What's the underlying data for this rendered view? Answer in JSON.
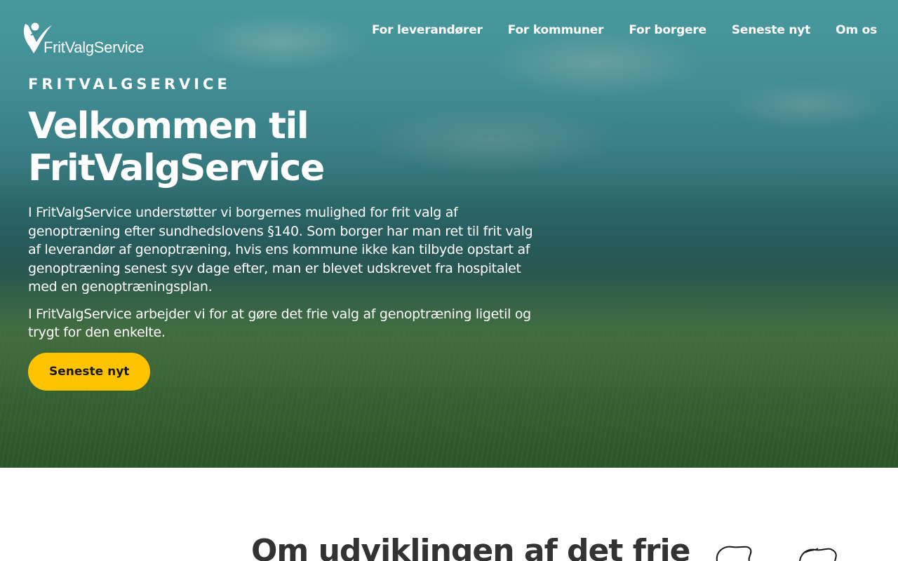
{
  "logo": {
    "text": "FritValgService",
    "icon": "checkmark-person-icon"
  },
  "nav": {
    "items": [
      {
        "label": "For leverandører"
      },
      {
        "label": "For kommuner"
      },
      {
        "label": "For borgere"
      },
      {
        "label": "Seneste nyt"
      },
      {
        "label": "Om os"
      }
    ]
  },
  "hero": {
    "eyebrow": "FRITVALGSERVICE",
    "title": "Velkommen til FritValgService",
    "paragraphs": [
      "I FritValgService understøtter vi borgernes mulighed for frit valg af genoptræning efter sundhedslovens §140. Som borger har man ret til frit valg af leverandør af genoptræning, hvis ens kommune ikke kan tilbyde opstart af genoptræning senest syv dage efter, man er blevet udskrevet fra hospitalet med en genoptræningsplan.",
      "I FritValgService arbejder vi for at gøre det frie valg af genoptræning ligetil og trygt for den enkelte."
    ],
    "cta_label": "Seneste nyt",
    "background": "hero-photo-beach-grass-sea"
  },
  "section": {
    "heading": "Om udviklingen af det frie",
    "illustration": "line-drawing-illustration"
  },
  "colors": {
    "accent": "#ffc400",
    "hero_overlay": "#3f8a92",
    "heading_text": "#333333"
  }
}
